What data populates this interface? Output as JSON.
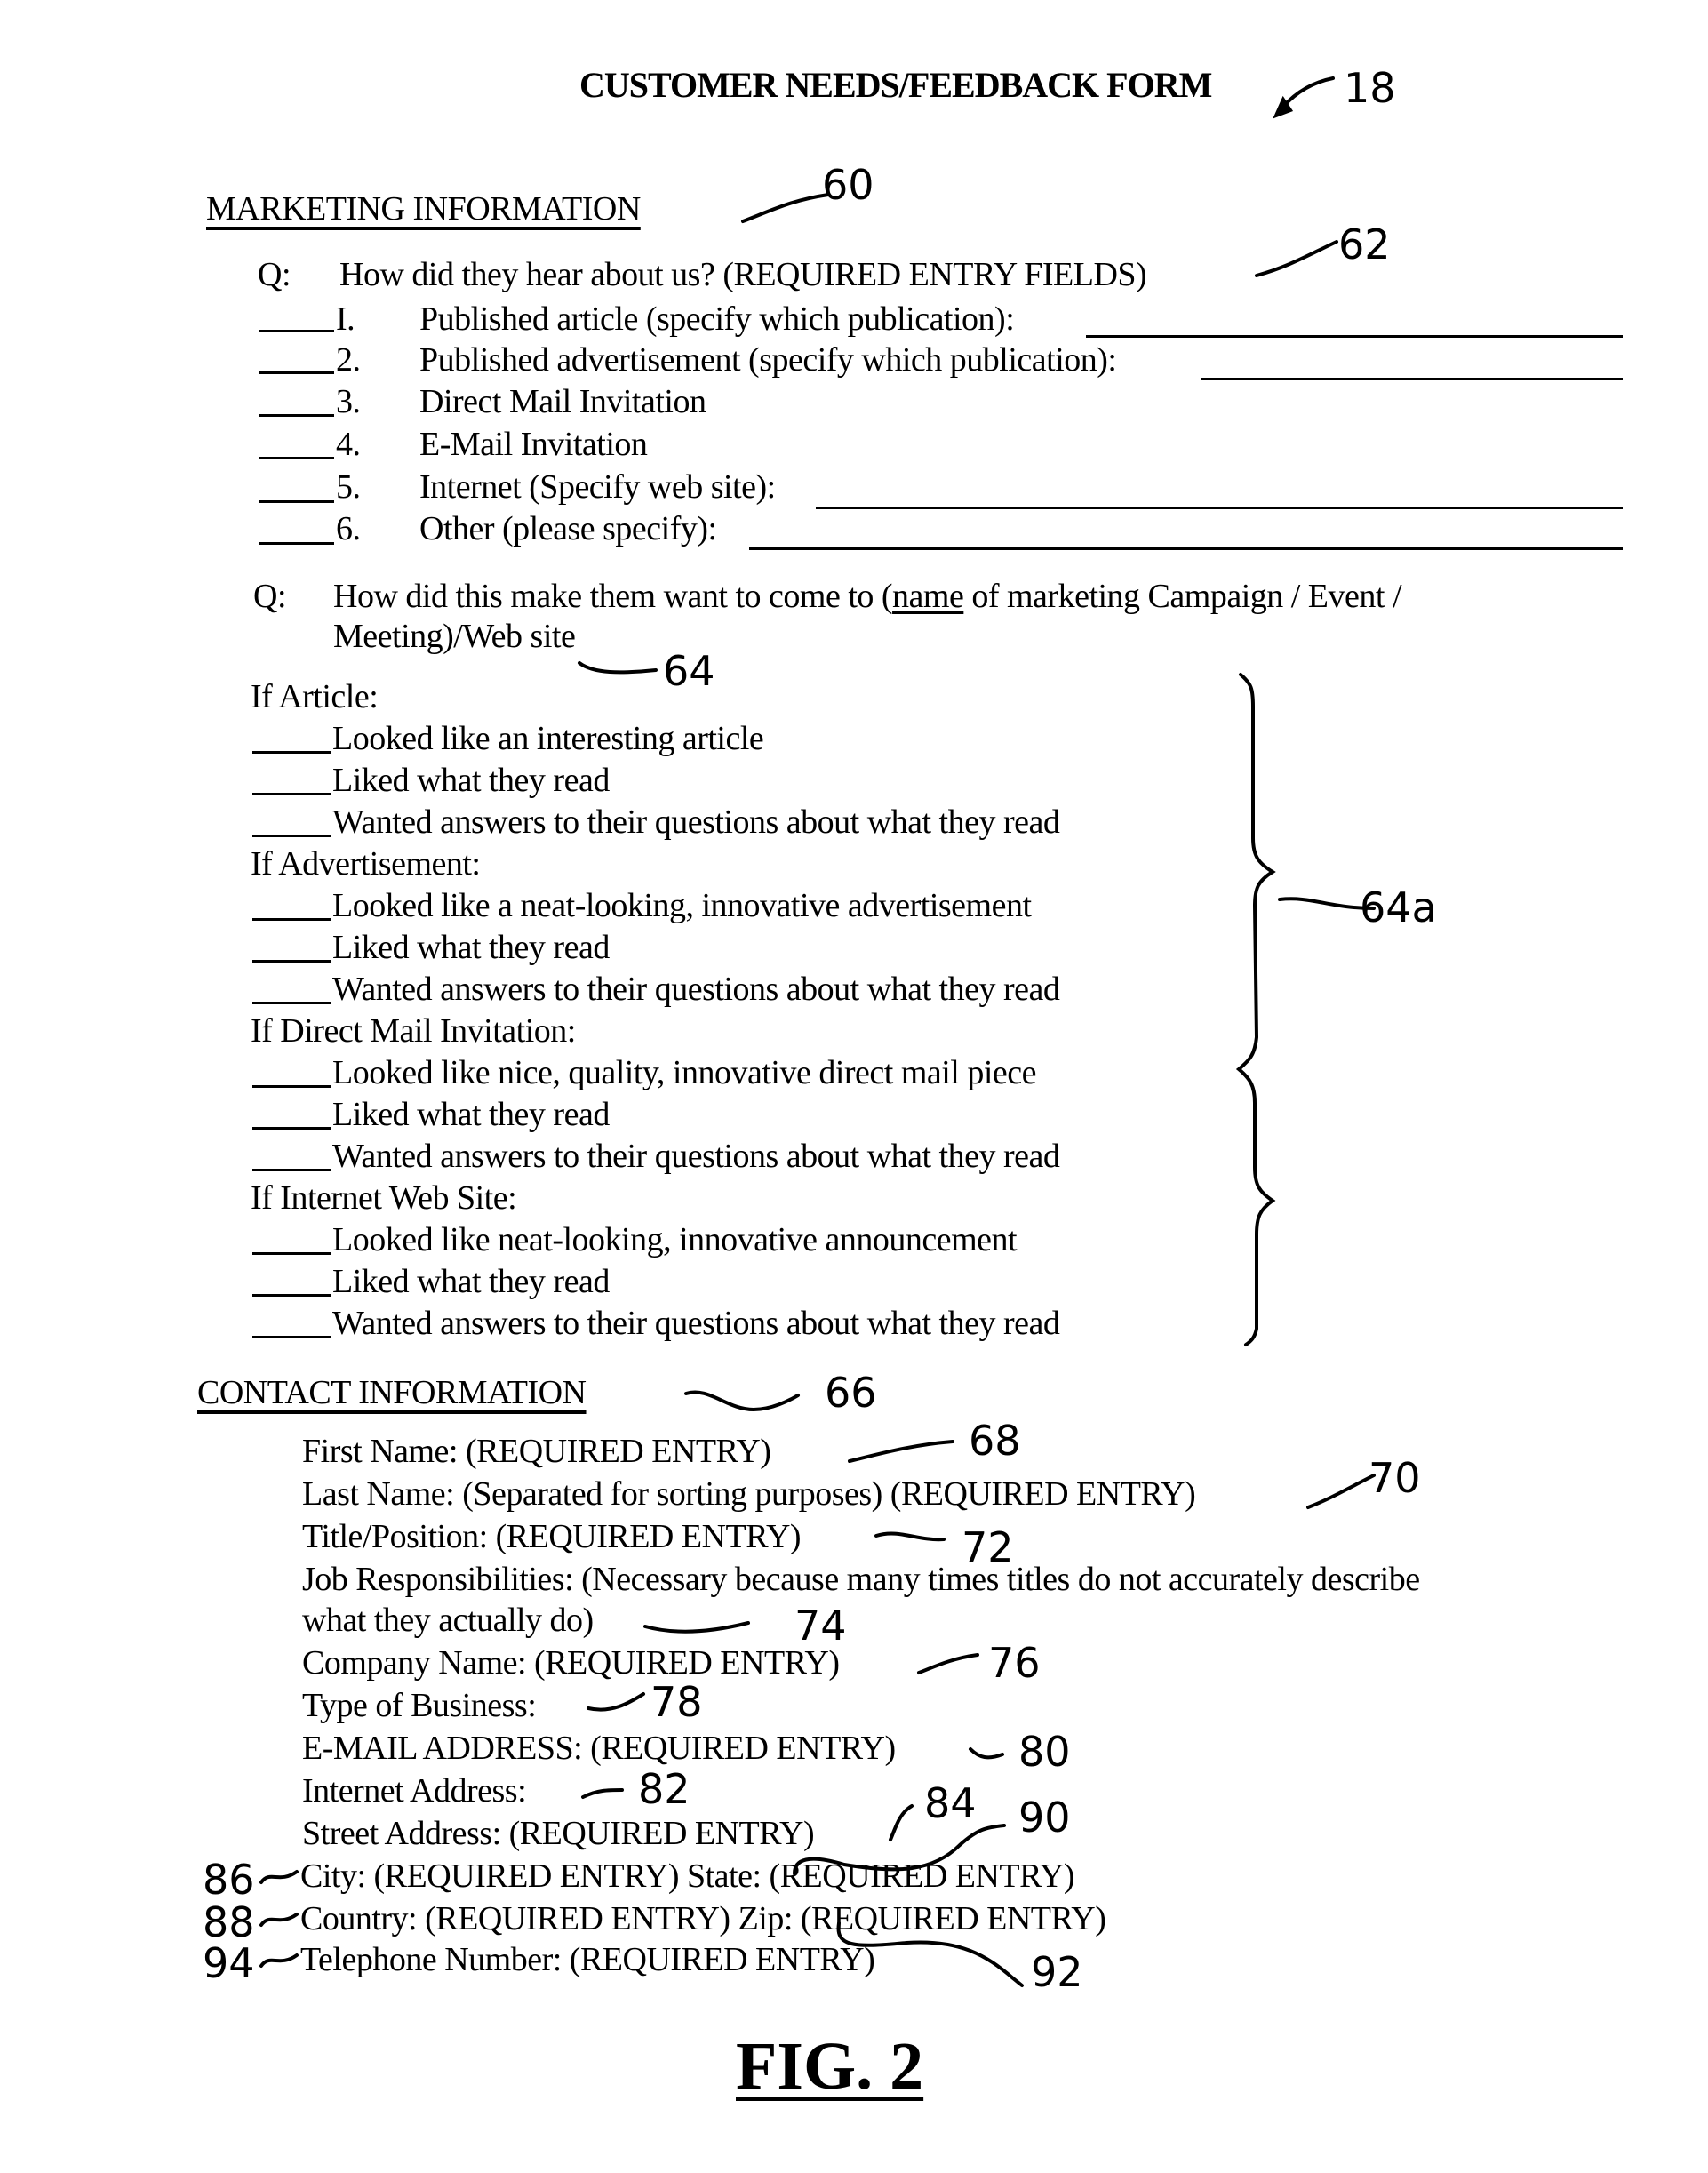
{
  "form_title": "CUSTOMER NEEDS/FEEDBACK FORM",
  "figure_label": "FIG. 2",
  "ref_numerals": {
    "form": "18",
    "marketing": "60",
    "q1": "62",
    "q2": "64",
    "brace": "64a",
    "contact": "66",
    "first_name": "68",
    "last_name": "70",
    "title_position": "72",
    "job_resp": "74",
    "company": "76",
    "business_type": "78",
    "email": "80",
    "internet": "82",
    "street": "84",
    "city": "86",
    "country": "88",
    "state": "90",
    "zip": "92",
    "telephone": "94"
  },
  "marketing": {
    "heading": "MARKETING INFORMATION",
    "q1": {
      "prefix": "Q:",
      "text": "How did they hear about us? (REQUIRED ENTRY FIELDS)",
      "options": [
        {
          "num": "I.",
          "label": "Published article (specify which publication):"
        },
        {
          "num": "2.",
          "label": "Published advertisement (specify which publication):"
        },
        {
          "num": "3.",
          "label": "Direct Mail Invitation"
        },
        {
          "num": "4.",
          "label": "E-Mail Invitation"
        },
        {
          "num": "5.",
          "label": "Internet (Specify web site):"
        },
        {
          "num": "6.",
          "label": "Other (please specify):"
        }
      ]
    },
    "q2": {
      "prefix": "Q:",
      "line1_before": "How did this make them want to come to (",
      "line1_underlined": "name",
      "line1_after": " of marketing Campaign / Event /",
      "line2": "Meeting)/Web site"
    },
    "groups": [
      {
        "heading": "If Article:",
        "items": [
          "Looked like an interesting article",
          "Liked what they read",
          "Wanted answers to their questions about what they read"
        ]
      },
      {
        "heading": "If Advertisement:",
        "items": [
          "Looked like a neat-looking, innovative advertisement",
          "Liked what they read",
          "Wanted answers to their questions about what they read"
        ]
      },
      {
        "heading": "If Direct Mail Invitation:",
        "items": [
          "Looked like nice, quality, innovative direct mail piece",
          "Liked what they read",
          "Wanted answers to their questions about what they read"
        ]
      },
      {
        "heading": "If Internet Web Site:",
        "items": [
          "Looked like neat-looking, innovative announcement",
          "Liked what they read",
          "Wanted answers to their questions about what they read"
        ]
      }
    ]
  },
  "contact": {
    "heading": "CONTACT INFORMATION",
    "fields": {
      "first_name": "First Name: (REQUIRED ENTRY)",
      "last_name": "Last Name: (Separated for sorting purposes) (REQUIRED ENTRY)",
      "title_position": "Title/Position: (REQUIRED ENTRY)",
      "job_resp_1": "Job Responsibilities: (Necessary because many times titles do not accurately describe",
      "job_resp_2": "what they actually do)",
      "company": "Company Name: (REQUIRED ENTRY)",
      "business_type": "Type of Business:",
      "email": "E-MAIL ADDRESS: (REQUIRED ENTRY)",
      "internet": "Internet Address:",
      "street": "Street Address: (REQUIRED ENTRY)",
      "city_state": "City: (REQUIRED ENTRY) State: (REQUIRED ENTRY)",
      "country_zip": "Country: (REQUIRED ENTRY) Zip: (REQUIRED ENTRY)",
      "telephone": "Telephone Number: (REQUIRED ENTRY)"
    }
  }
}
